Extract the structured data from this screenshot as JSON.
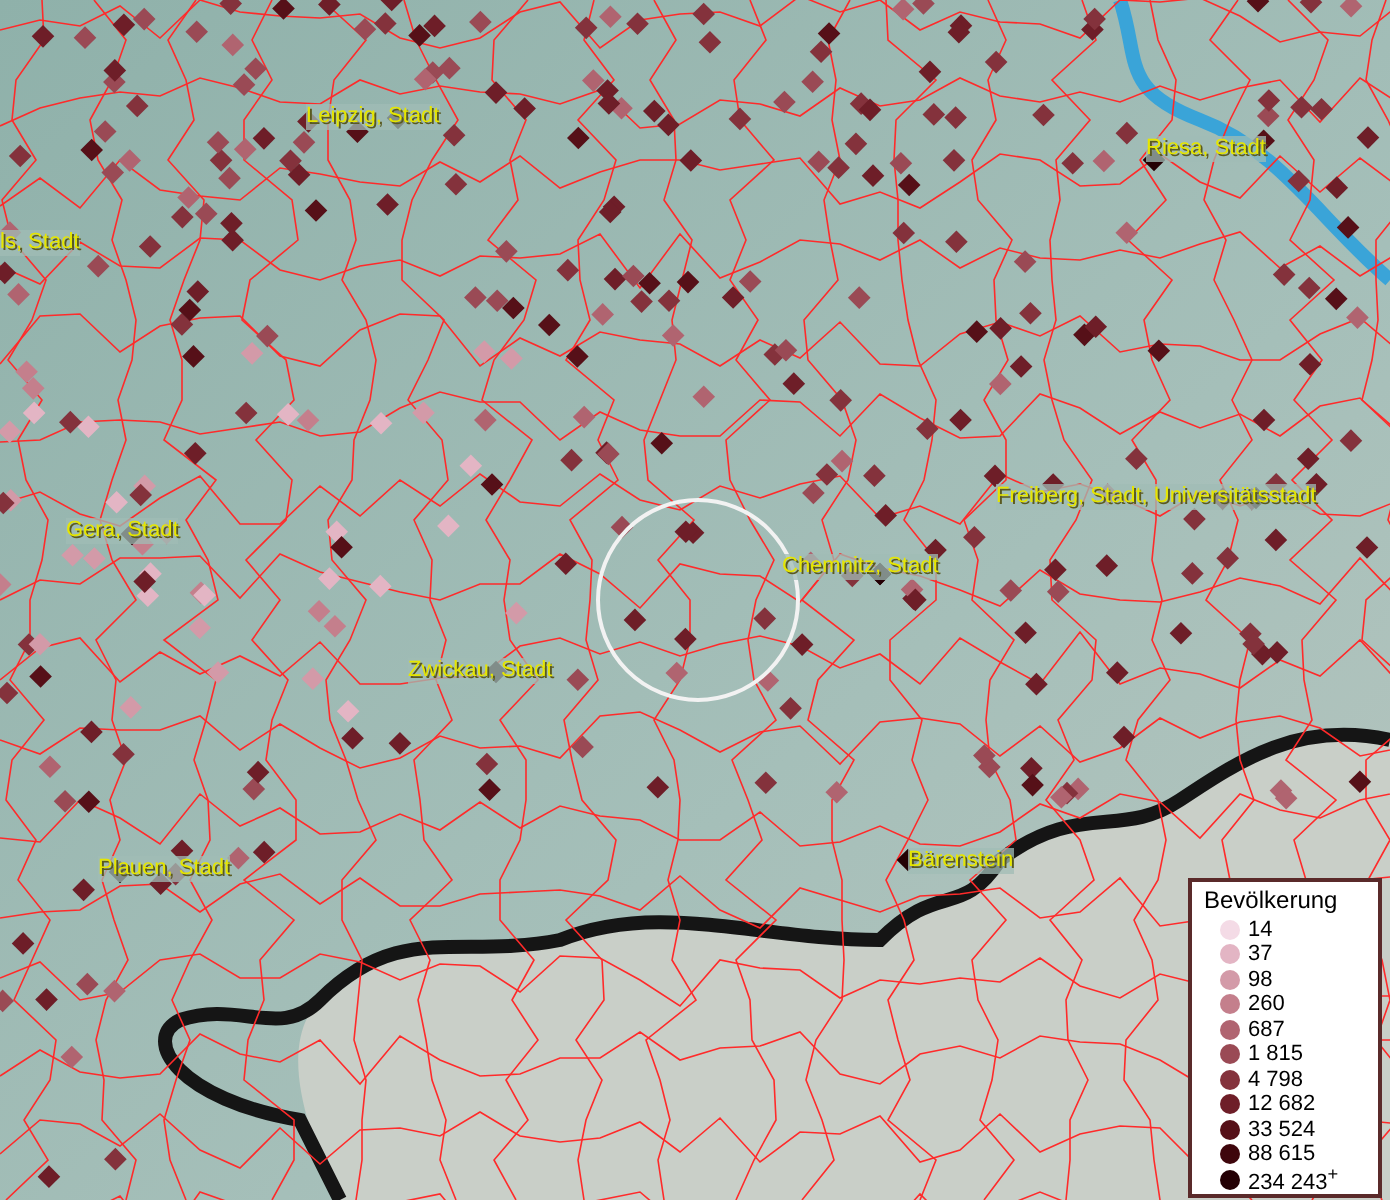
{
  "map": {
    "places": [
      {
        "name": "Leipzig, Stadt"
      },
      {
        "name": "ls, Stadt"
      },
      {
        "name": "Riesa, Stadt"
      },
      {
        "name": "Freiberg, Stadt, Universitätsstadt"
      },
      {
        "name": "Gera, Stadt"
      },
      {
        "name": "Chemnitz, Stadt"
      },
      {
        "name": "Zwickau, Stadt"
      },
      {
        "name": "Plauen, Stadt"
      },
      {
        "name": "Bärenstein"
      }
    ]
  },
  "legend": {
    "title": "Bevölkerung",
    "items": [
      {
        "label": "14",
        "color": "#f4dbe6"
      },
      {
        "label": "37",
        "color": "#e3b5c4"
      },
      {
        "label": "98",
        "color": "#d39aa8"
      },
      {
        "label": "260",
        "color": "#c47f8c"
      },
      {
        "label": "687",
        "color": "#b06470"
      },
      {
        "label": "1 815",
        "color": "#9a4a55"
      },
      {
        "label": "4 798",
        "color": "#84323c"
      },
      {
        "label": "12 682",
        "color": "#6e1e28"
      },
      {
        "label": "33 524",
        "color": "#561018"
      },
      {
        "label": "88 615",
        "color": "#3e060c"
      },
      {
        "label": "234 243$^{+}$",
        "color": "#240004"
      }
    ]
  }
}
